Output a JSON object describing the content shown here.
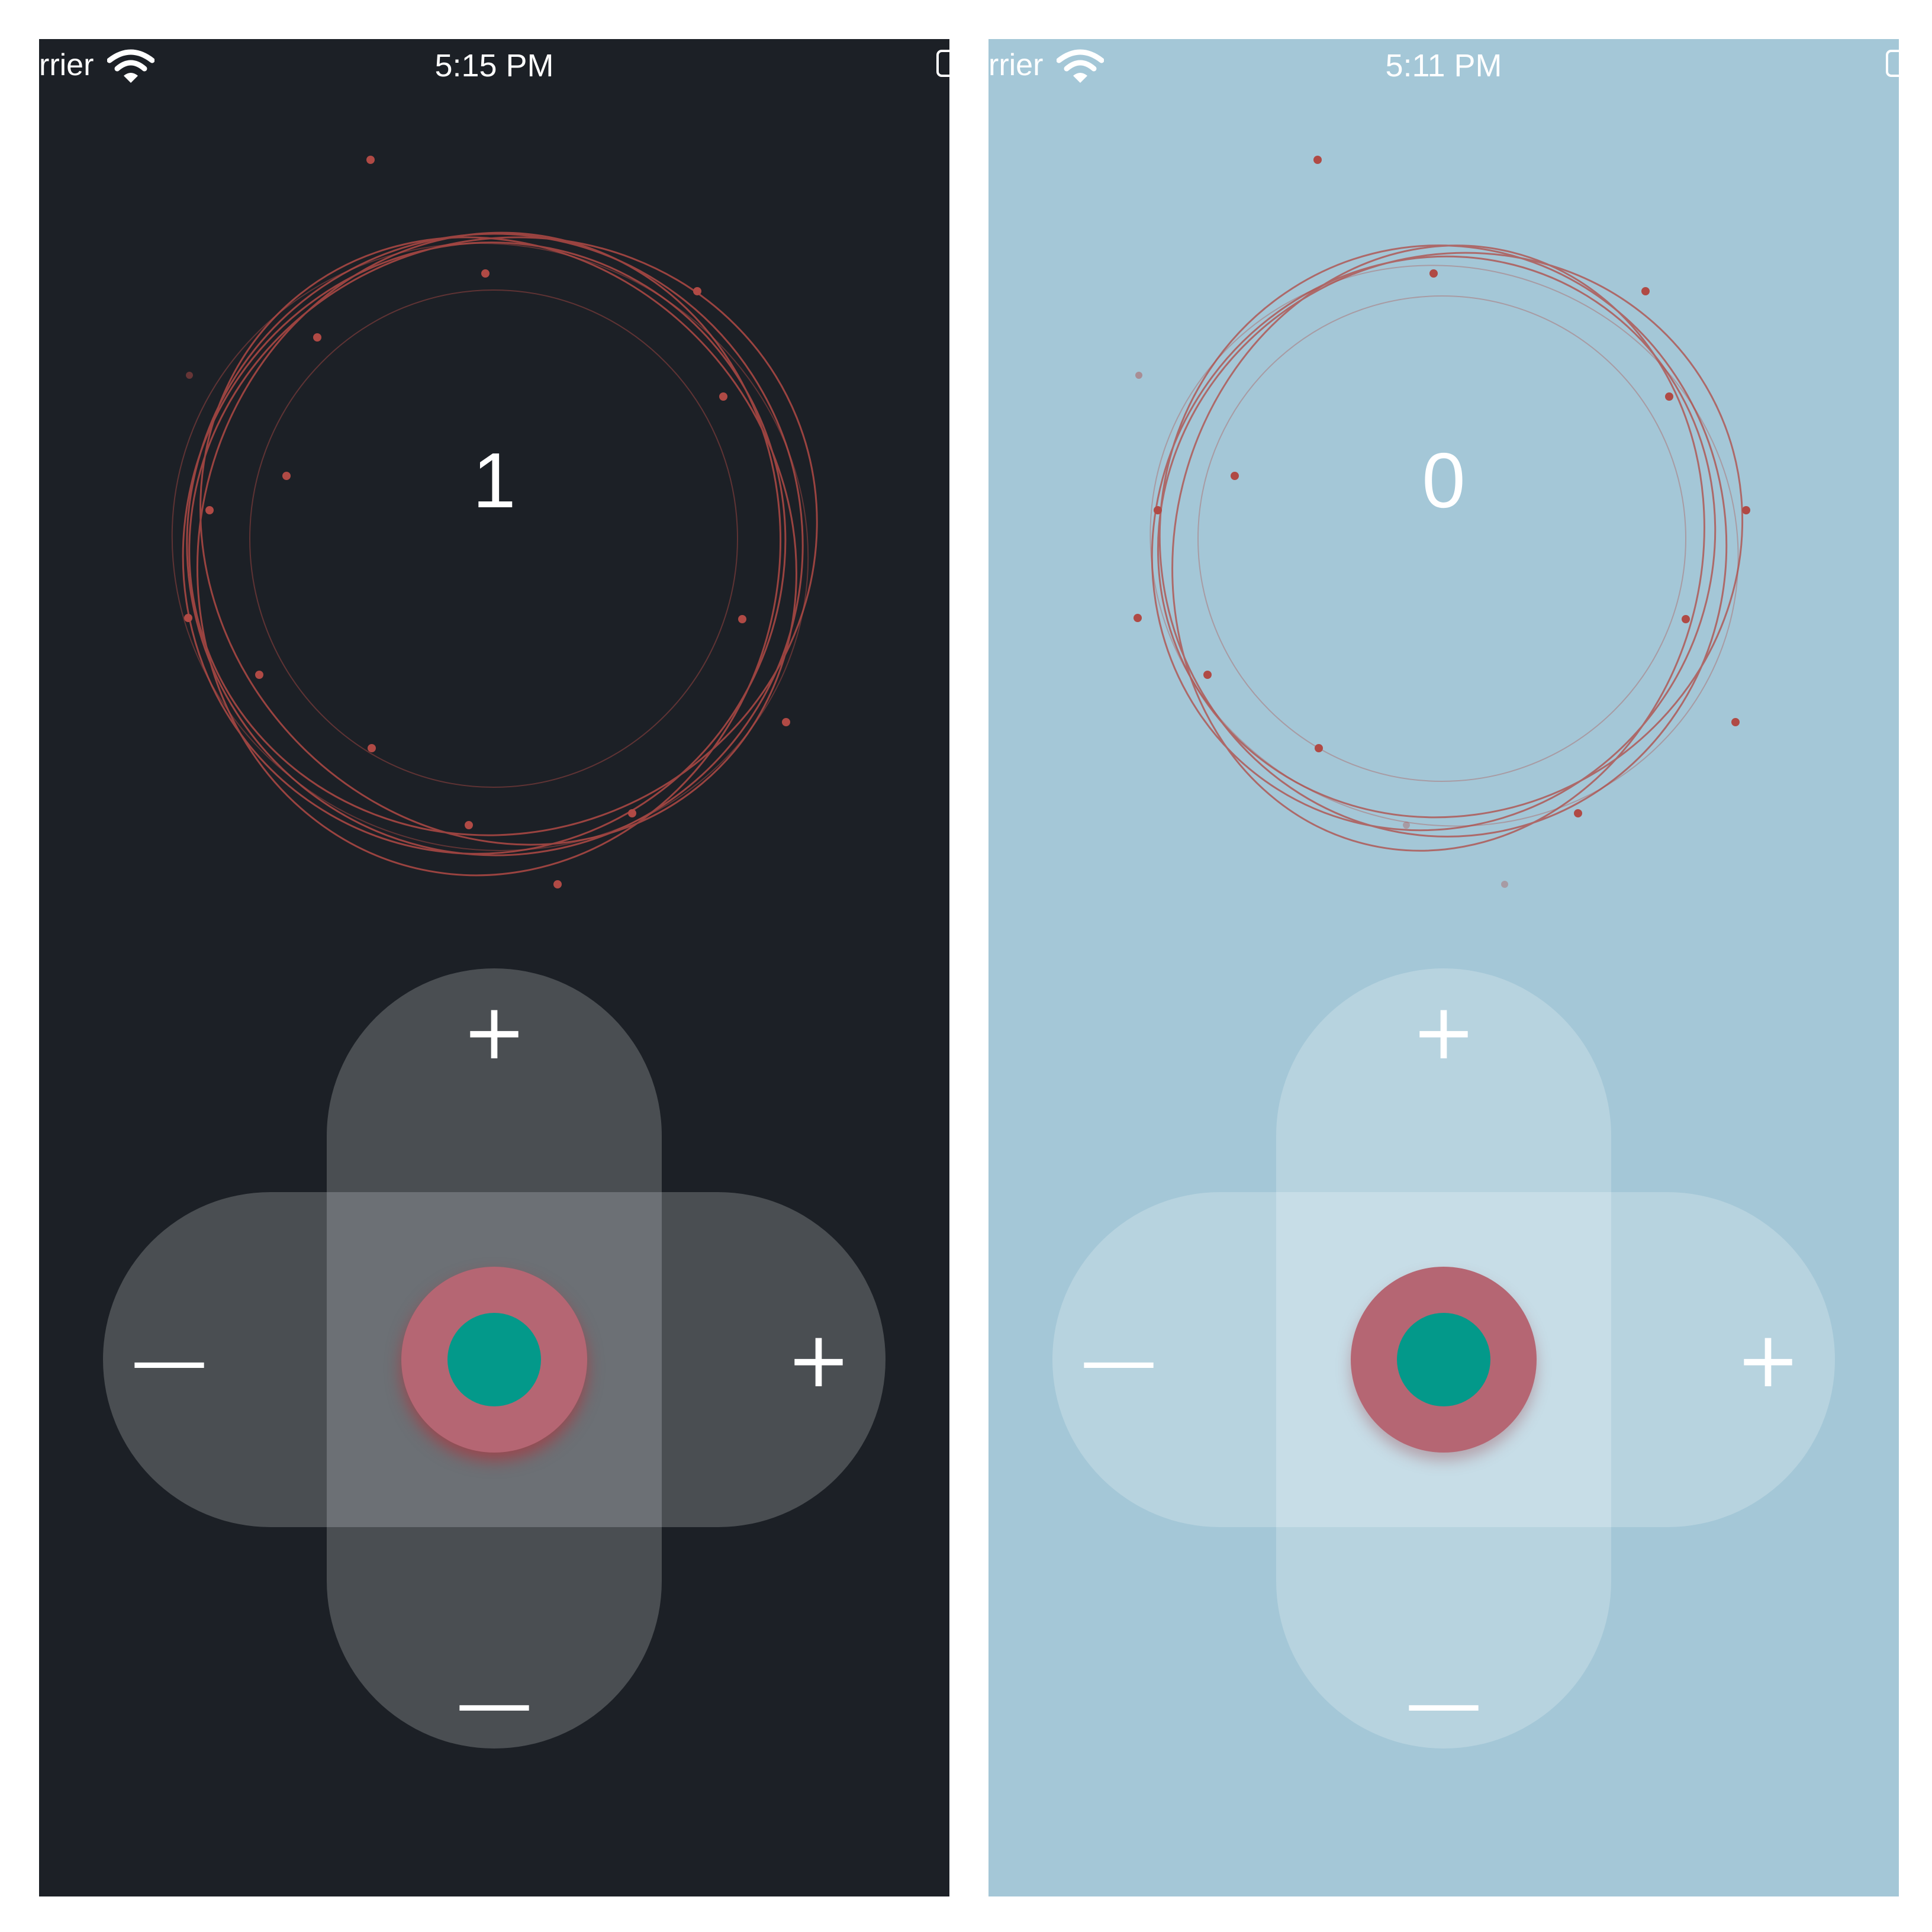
{
  "screens": [
    {
      "status": {
        "carrier": "rrier",
        "time": "5:15 PM"
      },
      "counter": "1",
      "controls": {
        "up_label": "+",
        "down_label": "—",
        "left_label": "—",
        "right_label": "+"
      },
      "theme": {
        "background": "#1c2026",
        "arm_fill": "#4a4e52",
        "center_fill": "#6c7075",
        "ring_color": "#b04a45",
        "knob_outer": "#b56673",
        "knob_inner": "#03998a"
      },
      "icons": [
        "wifi-icon",
        "battery-icon"
      ]
    },
    {
      "status": {
        "carrier": "rrier",
        "time": "5:11 PM"
      },
      "counter": "0",
      "controls": {
        "up_label": "+",
        "down_label": "—",
        "left_label": "—",
        "right_label": "+"
      },
      "theme": {
        "background": "#a4c7d7",
        "arm_fill": "#b7d3df",
        "center_fill": "#c7dde7",
        "ring_color": "#b04a45",
        "knob_outer": "#b56673",
        "knob_inner": "#03998a"
      },
      "icons": [
        "wifi-icon",
        "battery-icon"
      ]
    }
  ]
}
